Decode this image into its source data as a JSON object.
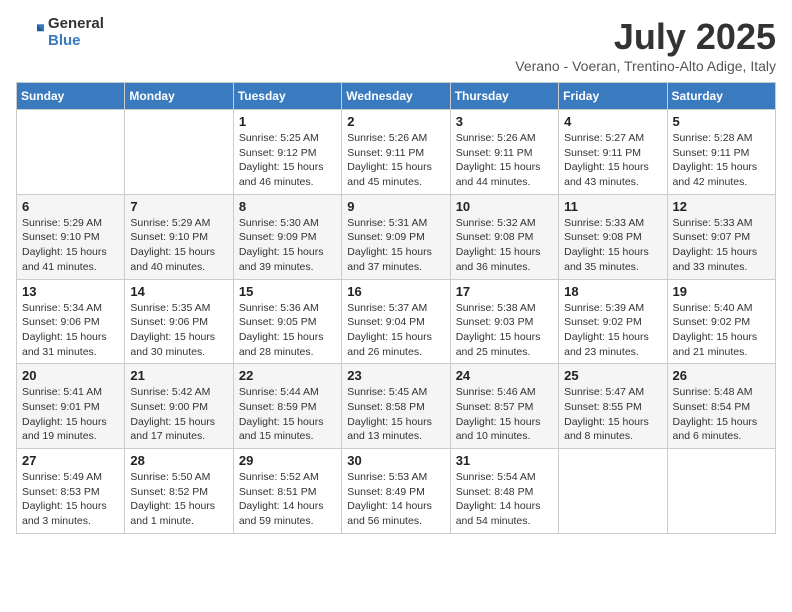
{
  "header": {
    "logo_line1": "General",
    "logo_line2": "Blue",
    "month_title": "July 2025",
    "location": "Verano - Voeran, Trentino-Alto Adige, Italy"
  },
  "days_of_week": [
    "Sunday",
    "Monday",
    "Tuesday",
    "Wednesday",
    "Thursday",
    "Friday",
    "Saturday"
  ],
  "weeks": [
    [
      {
        "day": "",
        "info": ""
      },
      {
        "day": "",
        "info": ""
      },
      {
        "day": "1",
        "info": "Sunrise: 5:25 AM\nSunset: 9:12 PM\nDaylight: 15 hours\nand 46 minutes."
      },
      {
        "day": "2",
        "info": "Sunrise: 5:26 AM\nSunset: 9:11 PM\nDaylight: 15 hours\nand 45 minutes."
      },
      {
        "day": "3",
        "info": "Sunrise: 5:26 AM\nSunset: 9:11 PM\nDaylight: 15 hours\nand 44 minutes."
      },
      {
        "day": "4",
        "info": "Sunrise: 5:27 AM\nSunset: 9:11 PM\nDaylight: 15 hours\nand 43 minutes."
      },
      {
        "day": "5",
        "info": "Sunrise: 5:28 AM\nSunset: 9:11 PM\nDaylight: 15 hours\nand 42 minutes."
      }
    ],
    [
      {
        "day": "6",
        "info": "Sunrise: 5:29 AM\nSunset: 9:10 PM\nDaylight: 15 hours\nand 41 minutes."
      },
      {
        "day": "7",
        "info": "Sunrise: 5:29 AM\nSunset: 9:10 PM\nDaylight: 15 hours\nand 40 minutes."
      },
      {
        "day": "8",
        "info": "Sunrise: 5:30 AM\nSunset: 9:09 PM\nDaylight: 15 hours\nand 39 minutes."
      },
      {
        "day": "9",
        "info": "Sunrise: 5:31 AM\nSunset: 9:09 PM\nDaylight: 15 hours\nand 37 minutes."
      },
      {
        "day": "10",
        "info": "Sunrise: 5:32 AM\nSunset: 9:08 PM\nDaylight: 15 hours\nand 36 minutes."
      },
      {
        "day": "11",
        "info": "Sunrise: 5:33 AM\nSunset: 9:08 PM\nDaylight: 15 hours\nand 35 minutes."
      },
      {
        "day": "12",
        "info": "Sunrise: 5:33 AM\nSunset: 9:07 PM\nDaylight: 15 hours\nand 33 minutes."
      }
    ],
    [
      {
        "day": "13",
        "info": "Sunrise: 5:34 AM\nSunset: 9:06 PM\nDaylight: 15 hours\nand 31 minutes."
      },
      {
        "day": "14",
        "info": "Sunrise: 5:35 AM\nSunset: 9:06 PM\nDaylight: 15 hours\nand 30 minutes."
      },
      {
        "day": "15",
        "info": "Sunrise: 5:36 AM\nSunset: 9:05 PM\nDaylight: 15 hours\nand 28 minutes."
      },
      {
        "day": "16",
        "info": "Sunrise: 5:37 AM\nSunset: 9:04 PM\nDaylight: 15 hours\nand 26 minutes."
      },
      {
        "day": "17",
        "info": "Sunrise: 5:38 AM\nSunset: 9:03 PM\nDaylight: 15 hours\nand 25 minutes."
      },
      {
        "day": "18",
        "info": "Sunrise: 5:39 AM\nSunset: 9:02 PM\nDaylight: 15 hours\nand 23 minutes."
      },
      {
        "day": "19",
        "info": "Sunrise: 5:40 AM\nSunset: 9:02 PM\nDaylight: 15 hours\nand 21 minutes."
      }
    ],
    [
      {
        "day": "20",
        "info": "Sunrise: 5:41 AM\nSunset: 9:01 PM\nDaylight: 15 hours\nand 19 minutes."
      },
      {
        "day": "21",
        "info": "Sunrise: 5:42 AM\nSunset: 9:00 PM\nDaylight: 15 hours\nand 17 minutes."
      },
      {
        "day": "22",
        "info": "Sunrise: 5:44 AM\nSunset: 8:59 PM\nDaylight: 15 hours\nand 15 minutes."
      },
      {
        "day": "23",
        "info": "Sunrise: 5:45 AM\nSunset: 8:58 PM\nDaylight: 15 hours\nand 13 minutes."
      },
      {
        "day": "24",
        "info": "Sunrise: 5:46 AM\nSunset: 8:57 PM\nDaylight: 15 hours\nand 10 minutes."
      },
      {
        "day": "25",
        "info": "Sunrise: 5:47 AM\nSunset: 8:55 PM\nDaylight: 15 hours\nand 8 minutes."
      },
      {
        "day": "26",
        "info": "Sunrise: 5:48 AM\nSunset: 8:54 PM\nDaylight: 15 hours\nand 6 minutes."
      }
    ],
    [
      {
        "day": "27",
        "info": "Sunrise: 5:49 AM\nSunset: 8:53 PM\nDaylight: 15 hours\nand 3 minutes."
      },
      {
        "day": "28",
        "info": "Sunrise: 5:50 AM\nSunset: 8:52 PM\nDaylight: 15 hours\nand 1 minute."
      },
      {
        "day": "29",
        "info": "Sunrise: 5:52 AM\nSunset: 8:51 PM\nDaylight: 14 hours\nand 59 minutes."
      },
      {
        "day": "30",
        "info": "Sunrise: 5:53 AM\nSunset: 8:49 PM\nDaylight: 14 hours\nand 56 minutes."
      },
      {
        "day": "31",
        "info": "Sunrise: 5:54 AM\nSunset: 8:48 PM\nDaylight: 14 hours\nand 54 minutes."
      },
      {
        "day": "",
        "info": ""
      },
      {
        "day": "",
        "info": ""
      }
    ]
  ]
}
